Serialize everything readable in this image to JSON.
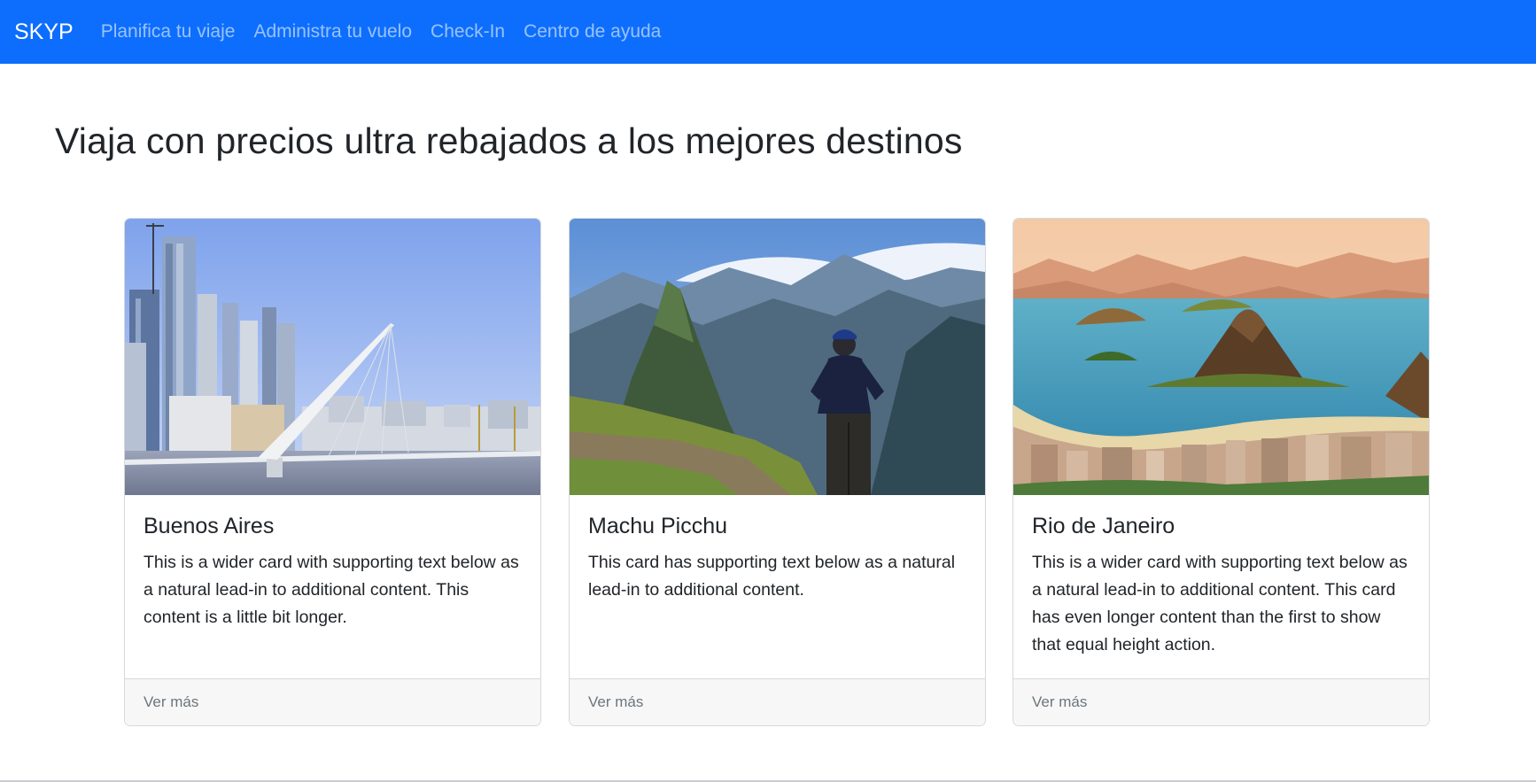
{
  "navbar": {
    "brand": "SKYP",
    "links": [
      {
        "label": "Planifica tu viaje"
      },
      {
        "label": "Administra tu vuelo"
      },
      {
        "label": "Check-In"
      },
      {
        "label": "Centro de ayuda"
      }
    ],
    "background_color": "#0d6efd"
  },
  "main": {
    "title": "Viaja con precios ultra rebajados a los mejores destinos",
    "cards": [
      {
        "title": "Buenos Aires",
        "text": "This is a wider card with supporting text below as a natural lead-in to additional content. This content is a little bit longer.",
        "footer": "Ver más",
        "image": "buenos-aires-bridge-skyline-photo"
      },
      {
        "title": "Machu Picchu",
        "text": "This card has supporting text below as a natural lead-in to additional content.",
        "footer": "Ver más",
        "image": "machu-picchu-hiker-photo"
      },
      {
        "title": "Rio de Janeiro",
        "text": "This is a wider card with supporting text below as a natural lead-in to additional content. This card has even longer content than the first to show that equal height action.",
        "footer": "Ver más",
        "image": "rio-de-janeiro-bay-photo"
      }
    ]
  }
}
